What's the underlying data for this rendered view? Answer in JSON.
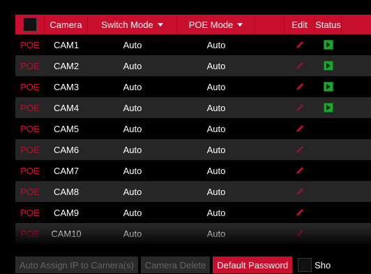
{
  "header": {
    "camera": "Camera",
    "switch_mode": "Switch Mode",
    "poe_mode": "POE Mode",
    "edit": "Edit",
    "status": "Status"
  },
  "rows": [
    {
      "type": "POE",
      "camera": "CAM1",
      "switch_mode": "Auto",
      "poe_mode": "Auto",
      "status": "online"
    },
    {
      "type": "POE",
      "camera": "CAM2",
      "switch_mode": "Auto",
      "poe_mode": "Auto",
      "status": "online"
    },
    {
      "type": "POE",
      "camera": "CAM3",
      "switch_mode": "Auto",
      "poe_mode": "Auto",
      "status": "online"
    },
    {
      "type": "POE",
      "camera": "CAM4",
      "switch_mode": "Auto",
      "poe_mode": "Auto",
      "status": "online"
    },
    {
      "type": "POE",
      "camera": "CAM5",
      "switch_mode": "Auto",
      "poe_mode": "Auto",
      "status": ""
    },
    {
      "type": "POE",
      "camera": "CAM6",
      "switch_mode": "Auto",
      "poe_mode": "Auto",
      "status": ""
    },
    {
      "type": "POE",
      "camera": "CAM7",
      "switch_mode": "Auto",
      "poe_mode": "Auto",
      "status": ""
    },
    {
      "type": "POE",
      "camera": "CAM8",
      "switch_mode": "Auto",
      "poe_mode": "Auto",
      "status": ""
    },
    {
      "type": "POE",
      "camera": "CAM9",
      "switch_mode": "Auto",
      "poe_mode": "Auto",
      "status": ""
    },
    {
      "type": "POE",
      "camera": "CAM10",
      "switch_mode": "Auto",
      "poe_mode": "Auto",
      "status": ""
    }
  ],
  "footer": {
    "auto_assign": "Auto Assign IP to Camera(s)",
    "camera_delete": "Camera Delete",
    "default_password": "Default Password",
    "show_label": "Sho"
  },
  "colors": {
    "accent": "#c8102e",
    "online": "#1aa52b"
  }
}
